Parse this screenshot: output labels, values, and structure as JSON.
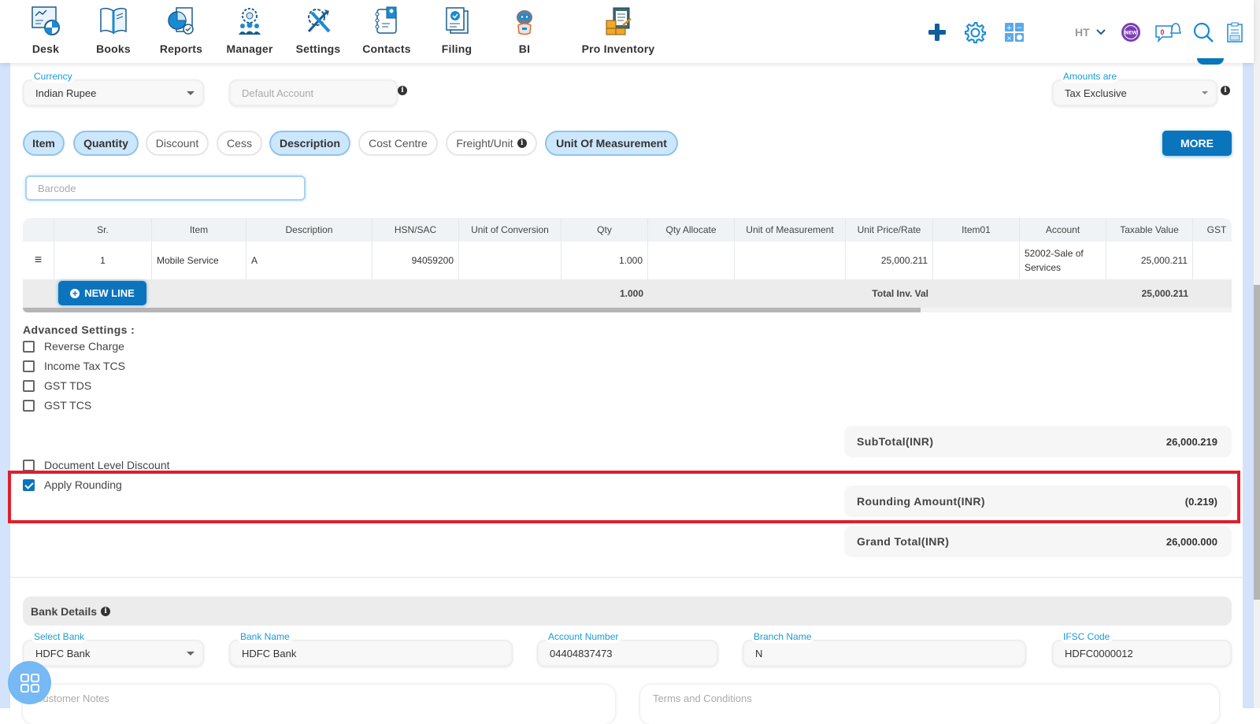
{
  "nav": {
    "items": [
      {
        "label": "Desk",
        "icon": "desk-icon"
      },
      {
        "label": "Books",
        "icon": "books-icon"
      },
      {
        "label": "Reports",
        "icon": "reports-icon"
      },
      {
        "label": "Manager",
        "icon": "manager-icon"
      },
      {
        "label": "Settings",
        "icon": "settings-icon"
      },
      {
        "label": "Contacts",
        "icon": "contacts-icon"
      },
      {
        "label": "Filing",
        "icon": "filing-icon"
      },
      {
        "label": "BI",
        "icon": "bi-robot-icon"
      },
      {
        "label": "Pro Inventory",
        "icon": "pro-inventory-icon"
      }
    ],
    "tools": {
      "user_initials": "HT",
      "notification_count": "0",
      "new_badge": "NEW"
    }
  },
  "form": {
    "currency": {
      "label": "Currency",
      "value": "Indian Rupee"
    },
    "default_account": {
      "placeholder": "Default Account"
    },
    "amounts_are": {
      "label": "Amounts are",
      "value": "Tax Exclusive"
    },
    "column_chips": [
      {
        "label": "Item",
        "active": true
      },
      {
        "label": "Quantity",
        "active": true
      },
      {
        "label": "Discount",
        "active": false
      },
      {
        "label": "Cess",
        "active": false
      },
      {
        "label": "Description",
        "active": true
      },
      {
        "label": "Cost Centre",
        "active": false
      },
      {
        "label": "Freight/Unit",
        "active": false
      },
      {
        "label": "Unit Of Measurement",
        "active": true
      }
    ],
    "more_button": "MORE",
    "barcode_placeholder": "Barcode"
  },
  "table": {
    "columns": [
      "",
      "Sr.",
      "Item",
      "Description",
      "HSN/SAC",
      "Unit of Conversion",
      "Qty",
      "Qty Allocate",
      "Unit of Measurement",
      "Unit Price/Rate",
      "Item01",
      "Account",
      "Taxable Value",
      "GST"
    ],
    "rows": [
      {
        "sr": "1",
        "item": "Mobile Service",
        "description": "A",
        "hsn": "94059200",
        "unit_conversion": "",
        "qty": "1.000",
        "qty_allocate": "",
        "uom": "",
        "unit_price": "25,000.211",
        "item01": "",
        "account": "52002-Sale of Services",
        "taxable_value": "25,000.211",
        "gst": ""
      }
    ],
    "footer": {
      "qty_total": "1.000",
      "total_label": "Total Inv. Val",
      "taxable_total": "25,000.211"
    },
    "new_line_button": "NEW LINE"
  },
  "advanced": {
    "title": "Advanced Settings :",
    "options": [
      {
        "label": "Reverse Charge",
        "checked": false
      },
      {
        "label": "Income Tax TCS",
        "checked": false
      },
      {
        "label": "GST TDS",
        "checked": false
      },
      {
        "label": "GST TCS",
        "checked": false
      }
    ],
    "document_level_discount": {
      "label": "Document Level Discount",
      "checked": false
    },
    "apply_rounding": {
      "label": "Apply Rounding",
      "checked": true
    }
  },
  "totals": {
    "subtotal": {
      "label": "SubTotal(INR)",
      "value": "26,000.219"
    },
    "rounding": {
      "label": "Rounding Amount(INR)",
      "value": "(0.219)"
    },
    "grand_total": {
      "label": "Grand Total(INR)",
      "value": "26,000.000"
    }
  },
  "bank": {
    "title": "Bank Details",
    "select_bank": {
      "label": "Select Bank",
      "value": "HDFC Bank"
    },
    "bank_name": {
      "label": "Bank Name",
      "value": "HDFC Bank"
    },
    "account_number": {
      "label": "Account Number",
      "value": "04404837473"
    },
    "branch_name": {
      "label": "Branch Name",
      "value": "N"
    },
    "ifsc": {
      "label": "IFSC Code",
      "value": "HDFC0000012"
    }
  },
  "notes": {
    "customer_notes_placeholder": "Customer Notes",
    "terms_placeholder": "Terms and Conditions"
  },
  "colors": {
    "primary": "#0a74bd",
    "chip_active_bg": "#cce6fb",
    "highlight_border": "#e01e2b",
    "label_blue": "#1a9bd7"
  }
}
